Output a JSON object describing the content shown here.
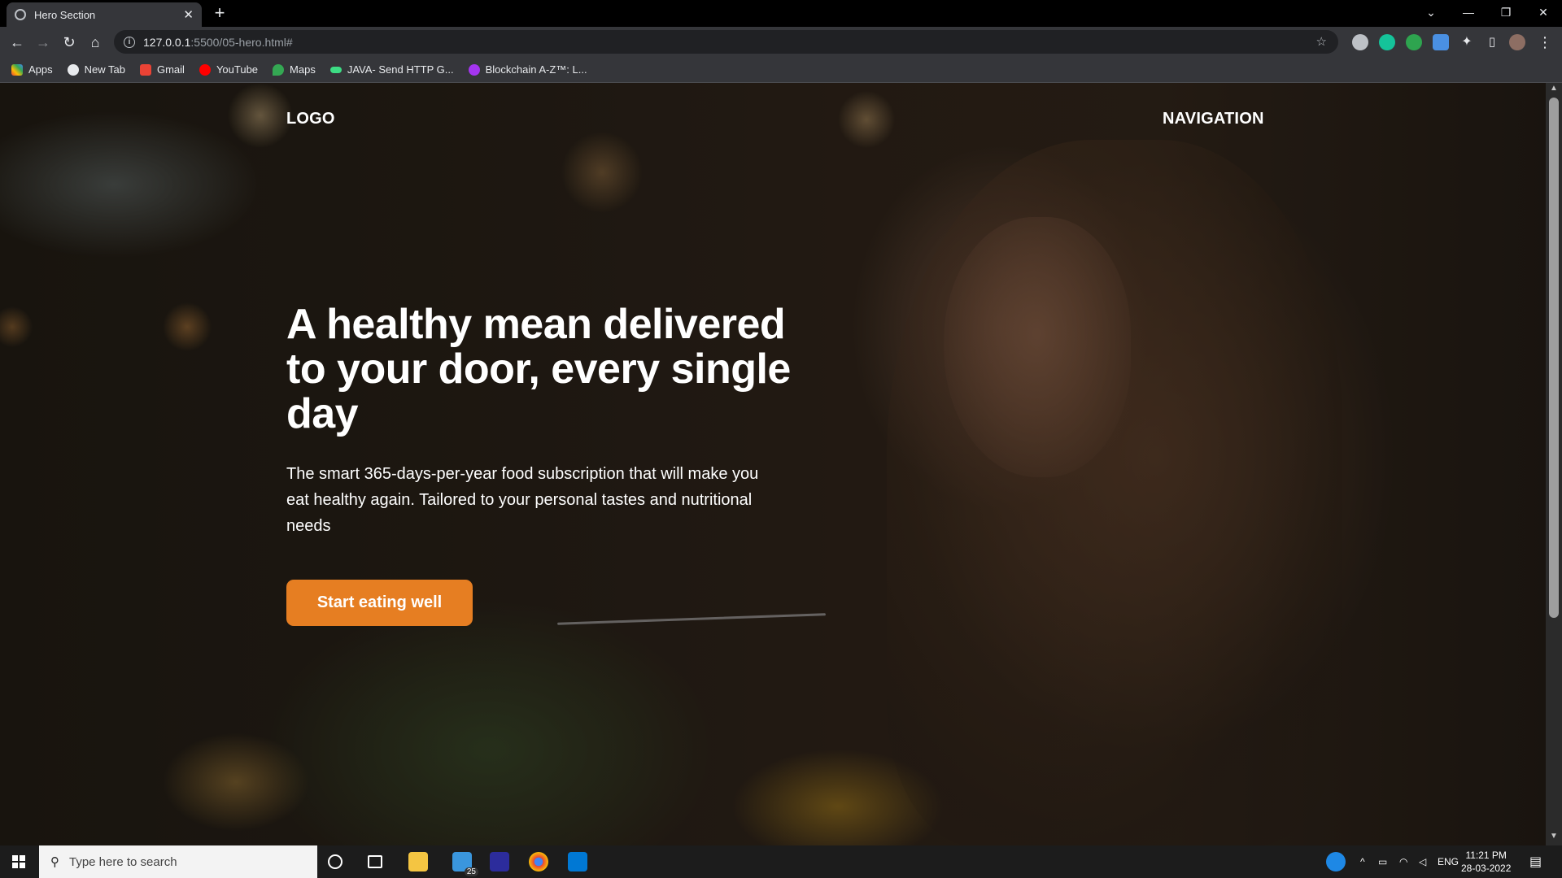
{
  "browser": {
    "tab_title": "Hero Section",
    "close_glyph": "✕",
    "new_tab_glyph": "+",
    "url_host": "127.0.0.1",
    "url_path": ":5500/05-hero.html#",
    "window_controls": [
      "⌄",
      "—",
      "❐",
      "✕"
    ]
  },
  "bookmarks": [
    {
      "label": "Apps",
      "icon": "apps-grid-icon",
      "color": "#e8453c"
    },
    {
      "label": "New Tab",
      "icon": "globe-icon",
      "color": "#e8eaed"
    },
    {
      "label": "Gmail",
      "icon": "gmail-icon",
      "color": "#ea4335"
    },
    {
      "label": "YouTube",
      "icon": "youtube-icon",
      "color": "#ff0000"
    },
    {
      "label": "Maps",
      "icon": "maps-icon",
      "color": "#34a853"
    },
    {
      "label": "JAVA- Send HTTP G...",
      "icon": "link-icon",
      "color": "#3ddc84"
    },
    {
      "label": "Blockchain A-Z™: L...",
      "icon": "udemy-icon",
      "color": "#a435f0"
    }
  ],
  "hero": {
    "logo": "LOGO",
    "navigation": "NAVIGATION",
    "headline": "A healthy mean delivered to your door, every single day",
    "subtext": "The smart 365-days-per-year food subscription that will make you eat healthy again. Tailored to your personal tastes and nutritional needs",
    "cta": "Start eating well",
    "accent_color": "#e67e22"
  },
  "taskbar": {
    "search_placeholder": "Type here to search",
    "badge_count": "25",
    "language": "ENG",
    "time": "11:21 PM",
    "date": "28-03-2022"
  }
}
